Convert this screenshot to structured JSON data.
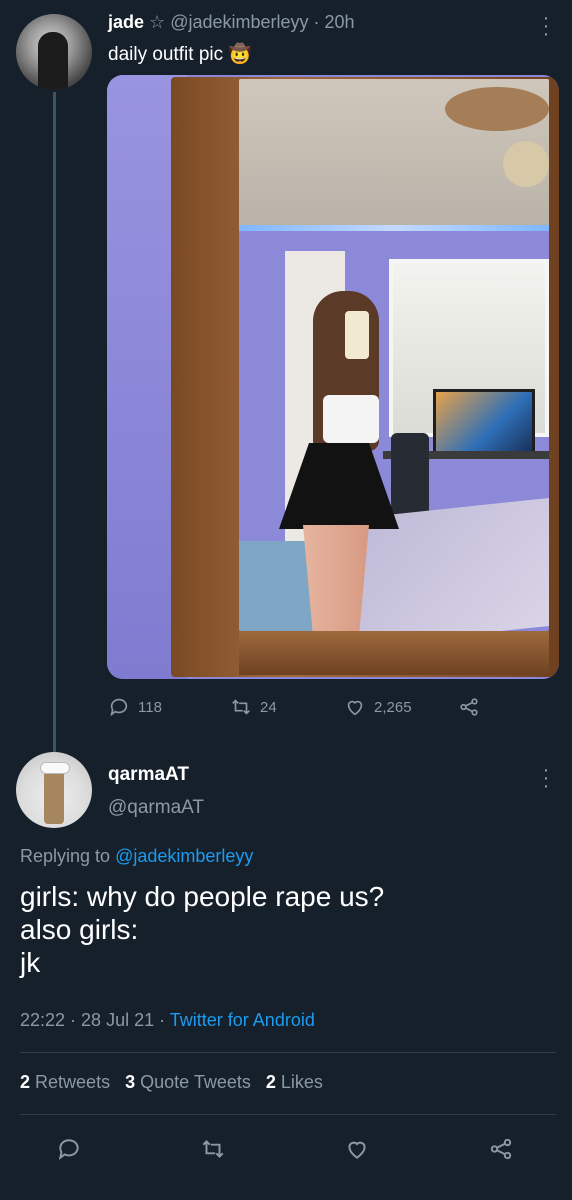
{
  "tweet1": {
    "name": "jade",
    "badge_icon": "star-outline-icon",
    "handle": "@jadekimberleyy",
    "time": "20h",
    "text": "daily outfit pic",
    "emoji": "🤠",
    "counts": {
      "replies": "118",
      "retweets": "24",
      "likes": "2,265"
    }
  },
  "tweet2": {
    "name": "qarmaAT",
    "handle": "@qarmaAT",
    "replying_prefix": "Replying to",
    "replying_to": "@jadekimberleyy",
    "body": [
      "girls: why do people rape us?",
      "also girls:",
      "jk"
    ],
    "time": "22:22",
    "date": "28 Jul 21",
    "source": "Twitter for Android",
    "stats": {
      "retweets_count": "2",
      "retweets_label": "Retweets",
      "quotes_count": "3",
      "quotes_label": "Quote Tweets",
      "likes_count": "2",
      "likes_label": "Likes"
    }
  },
  "colors": {
    "background": "#15202b",
    "muted": "#8b98a5",
    "link": "#1d9bf0"
  },
  "icons": [
    "reply-icon",
    "retweet-icon",
    "like-icon",
    "share-icon",
    "more-icon"
  ]
}
